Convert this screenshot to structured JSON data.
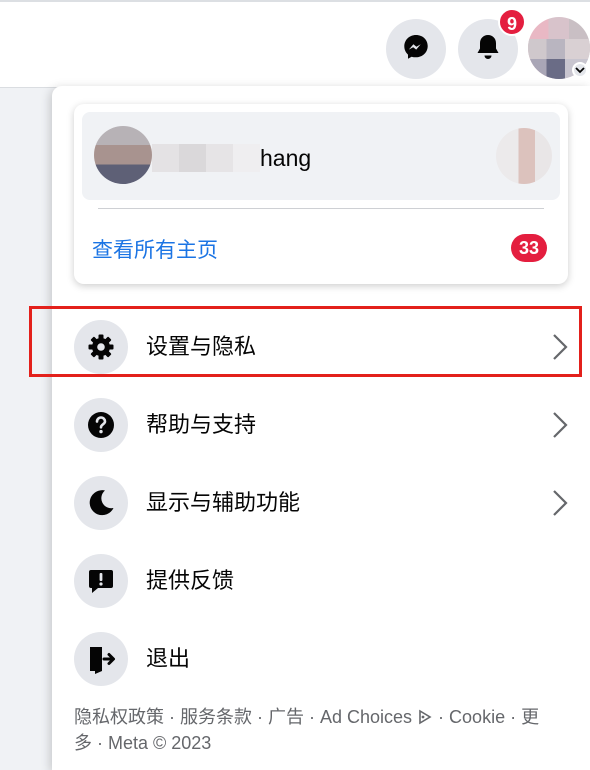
{
  "header": {
    "notification_count": "9",
    "messenger_icon": "messenger-icon",
    "bell_icon": "bell-icon"
  },
  "profile": {
    "name": "hang",
    "view_all_pages": "查看所有主页",
    "pages_badge": "33"
  },
  "menu": {
    "items": [
      {
        "label": "设置与隐私",
        "icon": "gear-icon",
        "chevron": true
      },
      {
        "label": "帮助与支持",
        "icon": "question-icon",
        "chevron": true
      },
      {
        "label": "显示与辅助功能",
        "icon": "moon-icon",
        "chevron": true
      },
      {
        "label": "提供反馈",
        "icon": "feedback-icon",
        "chevron": false
      },
      {
        "label": "退出",
        "icon": "logout-icon",
        "chevron": false
      }
    ]
  },
  "footer": {
    "line1": "隐私权政策 · 服务条款 · 广告 · Ad Choices ",
    "line1b": " · Cookie · 更",
    "line2": "多 · Meta © 2023"
  },
  "colors": {
    "accent": "#1b74e4",
    "badge": "#e41e3f",
    "highlight": "#e3201b"
  }
}
